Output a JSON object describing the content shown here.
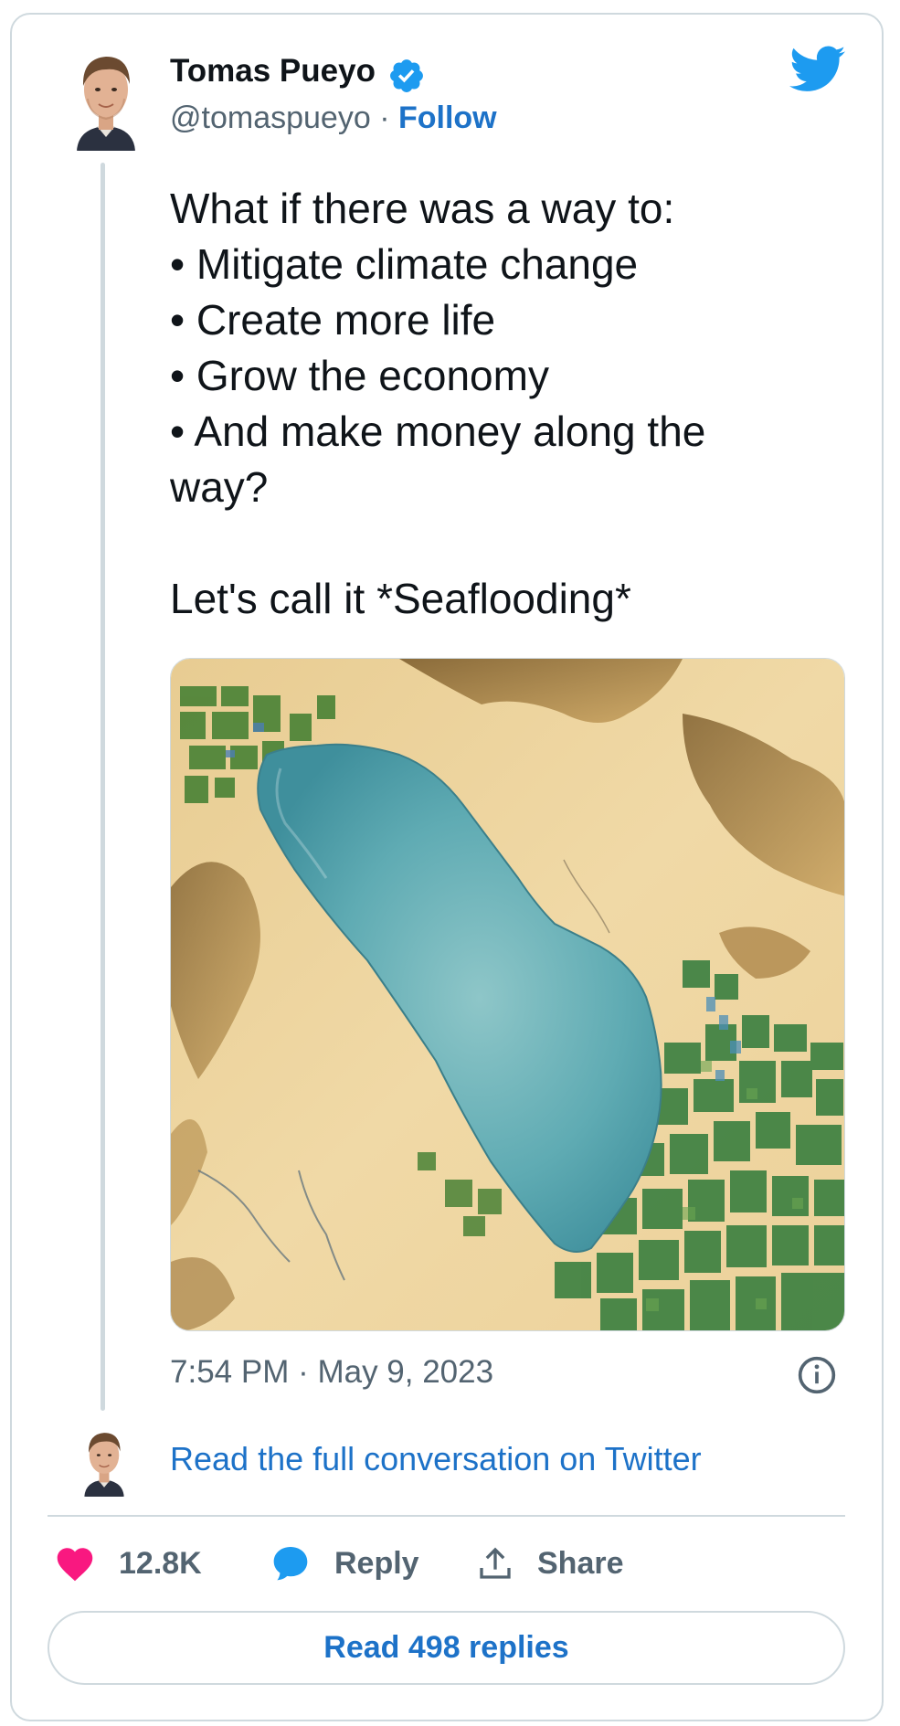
{
  "author": {
    "name": "Tomas Pueyo",
    "handle": "@tomaspueyo",
    "separator": "·",
    "follow_label": "Follow"
  },
  "tweet": {
    "lines": [
      "What if there was a way to:",
      "• Mitigate climate change",
      "• Create more life",
      "• Grow the economy",
      "• And make money along the",
      "way?",
      "",
      "Let's call it *Seaflooding*"
    ],
    "timestamp": "7:54 PM · May 9, 2023"
  },
  "conversation": {
    "link_label": "Read the full conversation on Twitter"
  },
  "actions": {
    "like_count": "12.8K",
    "reply_label": "Reply",
    "share_label": "Share"
  },
  "replies_button": {
    "label": "Read 498 replies"
  },
  "icons": {
    "brand": "twitter-bird-icon",
    "verified": "verified-badge-icon",
    "info": "info-icon",
    "like": "heart-icon",
    "reply": "speech-bubble-icon",
    "share": "share-upload-icon"
  },
  "colors": {
    "brand_blue": "#1d9bf0",
    "link_blue": "#1d72c8",
    "heart": "#f91880",
    "muted_text": "#536471",
    "border": "#cfd9de"
  }
}
